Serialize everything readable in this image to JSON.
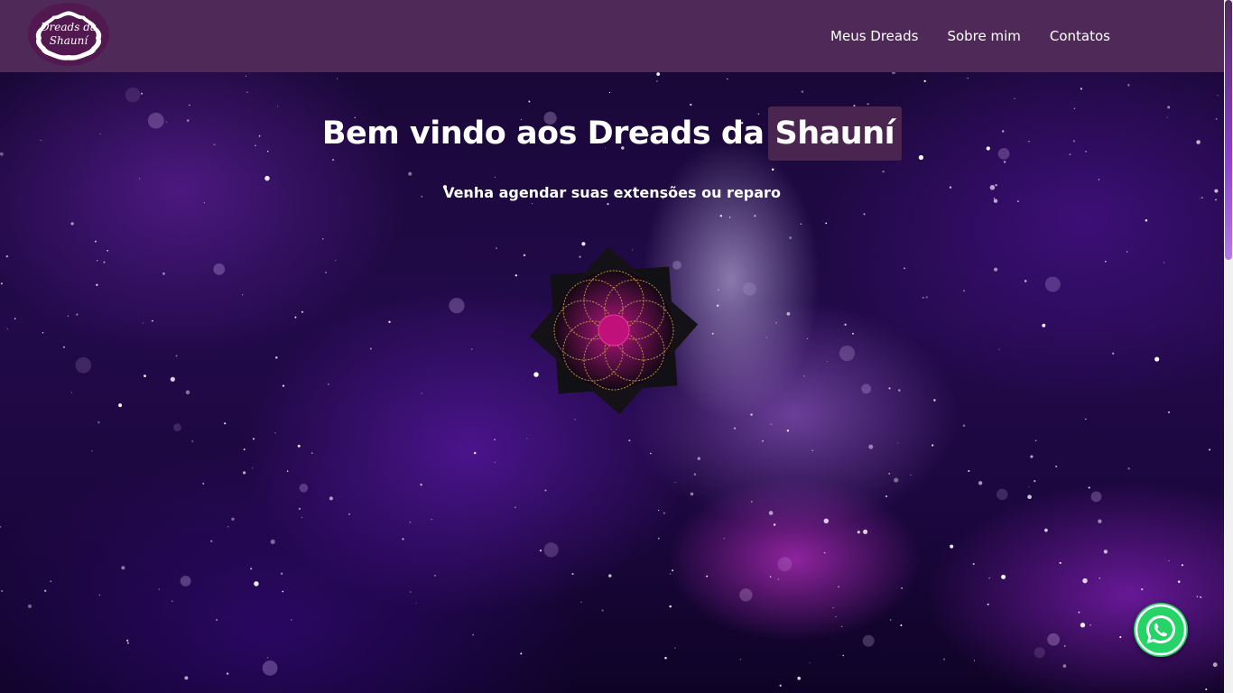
{
  "brand": {
    "logo_line1": "Dreads da",
    "logo_line2": "Shauní",
    "logo_icon": "scalloped-badge-logo"
  },
  "nav": {
    "items": [
      {
        "label": "Meus Dreads"
      },
      {
        "label": "Sobre mim"
      },
      {
        "label": "Contatos"
      }
    ]
  },
  "hero": {
    "title_prefix": "Bem vindo aos Dreads da",
    "title_highlight": "Shauní",
    "subtitle": "Venha agendar suas extensões ou reparo",
    "image_icon": "mandala-flower-icon"
  },
  "floating": {
    "whatsapp_icon": "whatsapp-icon"
  },
  "colors": {
    "navbar": "#4f2a58",
    "highlight_bg": "#4a2550",
    "whatsapp": "#25d366",
    "mandala_center": "#c0107a"
  }
}
